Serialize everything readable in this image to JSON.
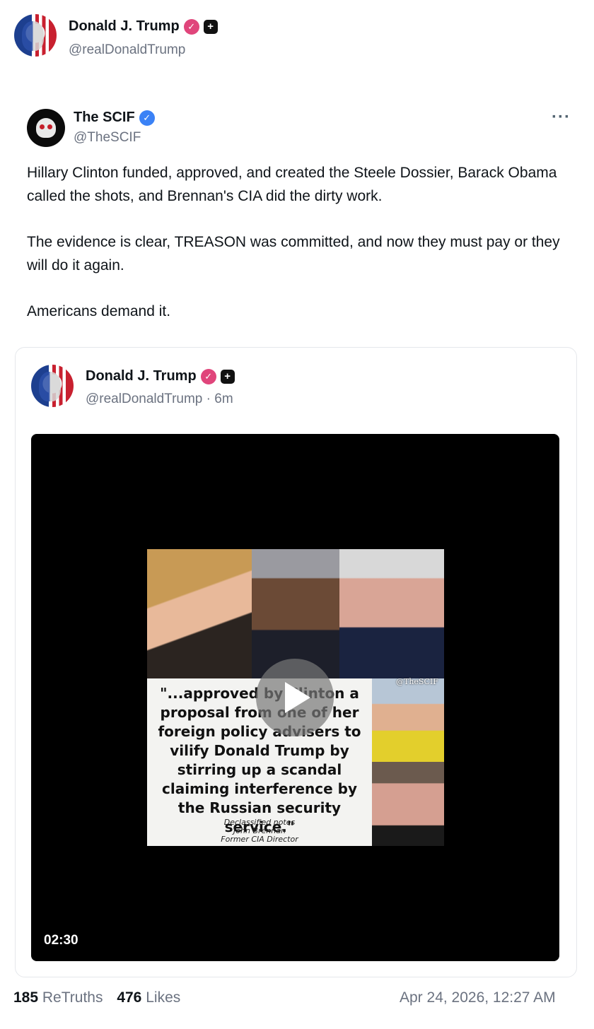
{
  "header": {
    "author_name": "Donald J. Trump",
    "author_handle": "@realDonaldTrump",
    "verified_icon": "verified-pink-icon",
    "plus_icon": "plus-badge-icon"
  },
  "quoted": {
    "author_name": "The SCIF",
    "author_handle": "@TheSCIF",
    "verified_icon": "verified-blue-icon",
    "more_label": "···",
    "text": [
      "Hillary Clinton funded, approved, and created the Steele Dossier, Barack Obama called the shots, and Brennan's CIA did the dirty work.",
      "The evidence is clear, TREASON was committed, and now they must pay or they will do it again.",
      "Americans demand it."
    ]
  },
  "embed": {
    "author_name": "Donald J. Trump",
    "author_handle_time": "@realDonaldTrump · 6m",
    "video": {
      "duration": "02:30",
      "quote_text": "\"...approved by Clinton a proposal from one of her foreign policy advisers to vilify Donald Trump by stirring up a scandal claiming interference by the Russian security service.\"",
      "quote_source": [
        "Declassified notes",
        "John Brennan",
        "Former CIA Director"
      ],
      "watermark": "@TheSCIF"
    }
  },
  "stats": {
    "retruths_count": "185",
    "retruths_label": "ReTruths",
    "likes_count": "476",
    "likes_label": "Likes",
    "timestamp": "Apr 24, 2026, 12:27 AM"
  }
}
